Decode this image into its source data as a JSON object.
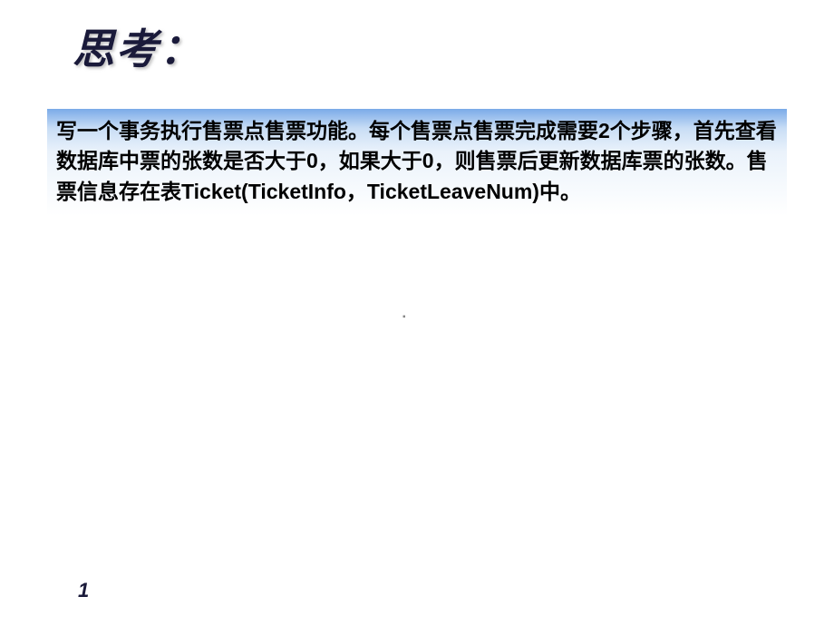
{
  "slide": {
    "heading": "思考：",
    "body_text": "写一个事务执行售票点售票功能。每个售票点售票完成需要2个步骤，首先查看数据库中票的张数是否大于0，如果大于0，则售票后更新数据库票的张数。售票信息存在表Ticket(TicketInfo，TicketLeaveNum)中。",
    "page_number": "1",
    "center_mark": "▪"
  }
}
